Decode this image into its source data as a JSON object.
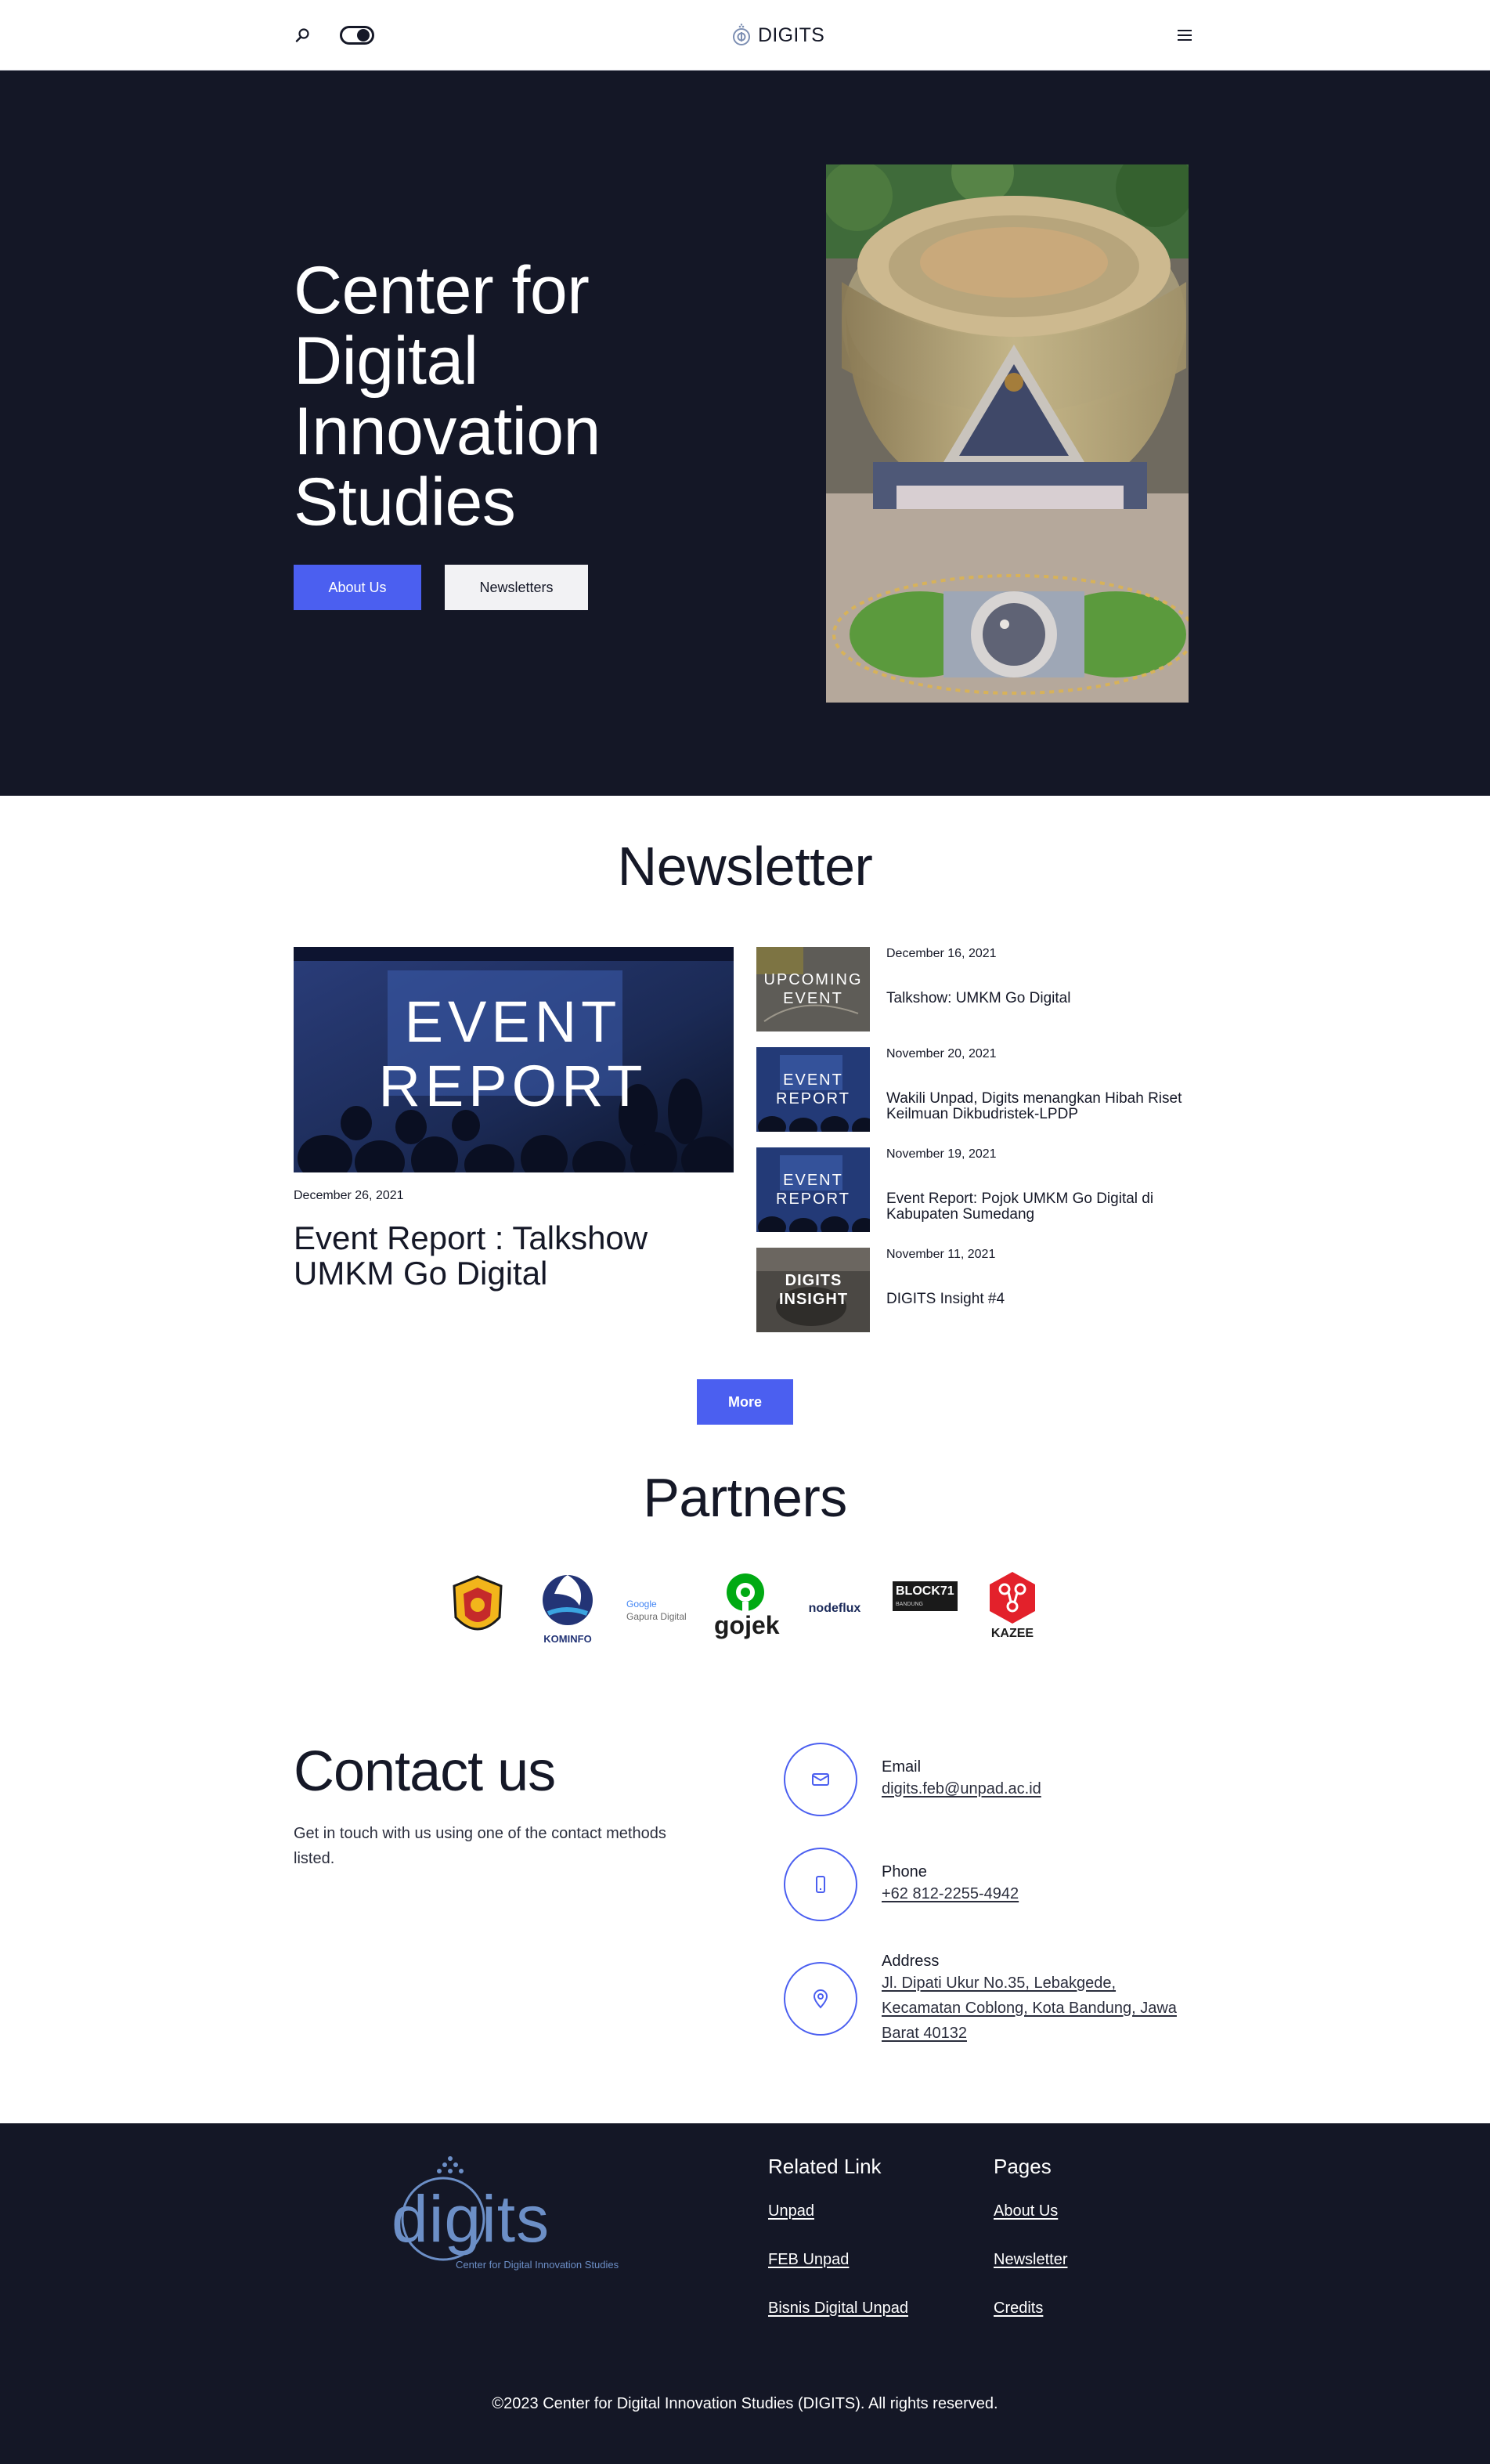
{
  "nav": {
    "brand": "DIGITS",
    "icons": {
      "search": "search-icon",
      "theme_toggle": "toggle-icon",
      "menu": "hamburger-menu-icon"
    }
  },
  "hero": {
    "title": "Center for Digital Innovation Studies",
    "buttons": {
      "about": "About Us",
      "newsletters": "Newsletters"
    },
    "image": "Aerial view of Universitas Padjadjaran rectorate building"
  },
  "newsletter": {
    "title": "Newsletter",
    "featured": {
      "thumb_text": "EVENT REPORT",
      "date": "December 26, 2021",
      "title": "Event Report : Talkshow UMKM Go Digital"
    },
    "items": [
      {
        "thumb_text": "UPCOMING EVENT",
        "date": "December 16, 2021",
        "title": "Talkshow: UMKM Go Digital"
      },
      {
        "thumb_text": "EVENT REPORT",
        "date": "November 20, 2021",
        "title": "Wakili Unpad, Digits menangkan Hibah Riset Keilmuan Dikbudristek-LPDP"
      },
      {
        "thumb_text": "EVENT REPORT",
        "date": "November 19, 2021",
        "title": "Event Report: Pojok UMKM Go Digital di Kabupaten Sumedang"
      },
      {
        "thumb_text": "DIGITS INSIGHT",
        "date": "November 11, 2021",
        "title": "DIGITS Insight #4"
      }
    ],
    "more": "More"
  },
  "partners": {
    "title": "Partners",
    "logos": [
      {
        "name": "Unpad"
      },
      {
        "name": "Kominfo",
        "text": "KOMINFO"
      },
      {
        "name": "Gapura Digital",
        "text_top": "Google",
        "text_bottom": "Gapura Digital"
      },
      {
        "name": "Gojek",
        "text": "gojek"
      },
      {
        "name": "Nodeflux",
        "text": "nodeflux"
      },
      {
        "name": "Block71",
        "text": "BLOCK71",
        "sub": "BANDUNG"
      },
      {
        "name": "Kazee",
        "text": "KAZEE"
      }
    ]
  },
  "contact": {
    "title": "Contact us",
    "description": "Get in touch with us using one of the contact methods listed.",
    "email": {
      "label": "Email",
      "value": "digits.feb@unpad.ac.id"
    },
    "phone": {
      "label": "Phone",
      "value": "+62 812-2255-4942"
    },
    "address": {
      "label": "Address",
      "value": "Jl. Dipati Ukur No.35, Lebakgede, Kecamatan Coblong, Kota Bandung, Jawa Barat 40132"
    }
  },
  "footer": {
    "logo_text": "digits",
    "logo_tagline": "Center for Digital Innovation Studies",
    "related": {
      "heading": "Related Link",
      "links": [
        "Unpad",
        "FEB Unpad",
        "Bisnis Digital Unpad"
      ]
    },
    "pages": {
      "heading": "Pages",
      "links": [
        "About Us",
        "Newsletter",
        "Credits"
      ]
    },
    "copyright": "©2023 Center for Digital Innovation Studies (DIGITS). All rights reserved."
  },
  "colors": {
    "dark": "#141726",
    "accent": "#4b5ff0",
    "light_button": "#f2f2f4"
  }
}
